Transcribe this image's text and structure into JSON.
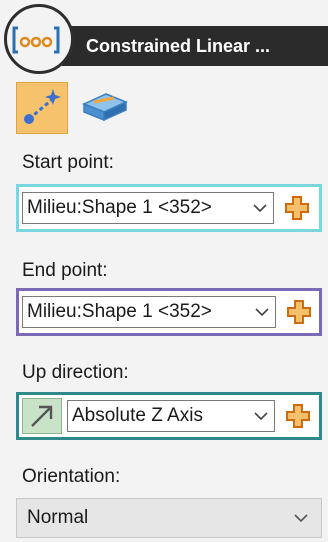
{
  "header": {
    "title": "Constrained Linear ...",
    "icon": "constrained-linear-icon"
  },
  "toolbar": {
    "buttons": [
      {
        "icon": "point-to-point-icon",
        "active": true
      },
      {
        "icon": "surface-path-icon",
        "active": false
      }
    ]
  },
  "start_point": {
    "label": "Start point:",
    "value": "Milieu:Shape 1 <352>",
    "frame_color": "#7ad6df"
  },
  "end_point": {
    "label": "End point:",
    "value": "Milieu:Shape 1 <352>",
    "frame_color": "#7c69b5"
  },
  "up_direction": {
    "label": "Up direction:",
    "value": "Absolute Z Axis",
    "frame_color": "#2e8a8a",
    "axis_icon": "diagonal-arrow-icon"
  },
  "orientation": {
    "label": "Orientation:",
    "value": "Normal"
  },
  "colors": {
    "pick_plus": "#e8891a",
    "active_tool": "#f6c26c"
  }
}
